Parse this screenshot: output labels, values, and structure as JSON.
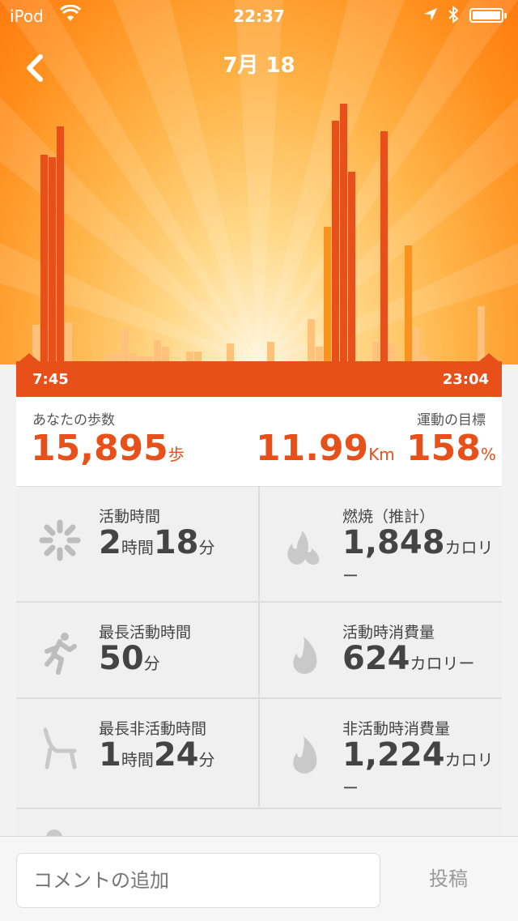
{
  "status": {
    "carrier": "iPod",
    "time": "22:37"
  },
  "header": {
    "title": "7月 18"
  },
  "timeline": {
    "start": "7:45",
    "end": "23:04"
  },
  "chart_data": {
    "type": "bar",
    "bars": [
      {
        "h": 45,
        "c": "light"
      },
      {
        "h": 255,
        "c": "dark"
      },
      {
        "h": 252,
        "c": "dark"
      },
      {
        "h": 290,
        "c": "dark"
      },
      {
        "h": 48,
        "c": "light"
      },
      {
        "h": 10,
        "c": "light"
      },
      {
        "h": 10,
        "c": "light"
      },
      {
        "h": 40,
        "c": "light"
      },
      {
        "h": 10,
        "c": "light"
      },
      {
        "h": 6,
        "c": "light"
      },
      {
        "h": 6,
        "c": "light"
      },
      {
        "h": 26,
        "c": "light"
      },
      {
        "h": 18,
        "c": "light"
      },
      {
        "h": 12,
        "c": "light"
      },
      {
        "h": 12,
        "c": "light"
      },
      {
        "h": 22,
        "c": "light"
      },
      {
        "h": 24,
        "c": "light"
      },
      {
        "h": 52,
        "c": "light"
      },
      {
        "h": 18,
        "c": "light"
      },
      {
        "h": 166,
        "c": "mid"
      },
      {
        "h": 297,
        "c": "dark"
      },
      {
        "h": 318,
        "c": "dark"
      },
      {
        "h": 234,
        "c": "dark"
      },
      {
        "h": 24,
        "c": "light"
      },
      {
        "h": 284,
        "c": "dark"
      },
      {
        "h": 22,
        "c": "light"
      },
      {
        "h": 143,
        "c": "mid"
      },
      {
        "h": 42,
        "c": "light"
      },
      {
        "h": 8,
        "c": "light"
      },
      {
        "h": 68,
        "c": "light"
      }
    ],
    "colors": {
      "dark": "#e8501a",
      "mid": "#f7931e",
      "light": "#ffc27a"
    }
  },
  "summary": {
    "steps_label": "あなたの歩数",
    "steps_value": "15,895",
    "steps_unit": "歩",
    "goal_label": "運動の目標",
    "distance_value": "11.99",
    "distance_unit": "Km",
    "goal_value": "158",
    "goal_unit": "%"
  },
  "stats": {
    "active_time": {
      "label": "活動時間",
      "v1": "2",
      "u1": "時間",
      "v2": "18",
      "u2": "分"
    },
    "burn": {
      "label": "燃焼（推計）",
      "value": "1,848",
      "unit": "カロリ",
      "unit2": "ー"
    },
    "longest_active": {
      "label": "最長活動時間",
      "value": "50",
      "unit": "分"
    },
    "active_burn": {
      "label": "活動時消費量",
      "value": "624",
      "unit": "カロリー"
    },
    "longest_idle": {
      "label": "最長非活動時間",
      "v1": "1",
      "u1": "時間",
      "v2": "24",
      "u2": "分"
    },
    "idle_burn": {
      "label": "非活動時消費量",
      "value": "1,224",
      "unit": "カロリ",
      "unit2": "ー"
    }
  },
  "footer": {
    "comment_placeholder": "コメントの追加",
    "post_label": "投稿"
  }
}
